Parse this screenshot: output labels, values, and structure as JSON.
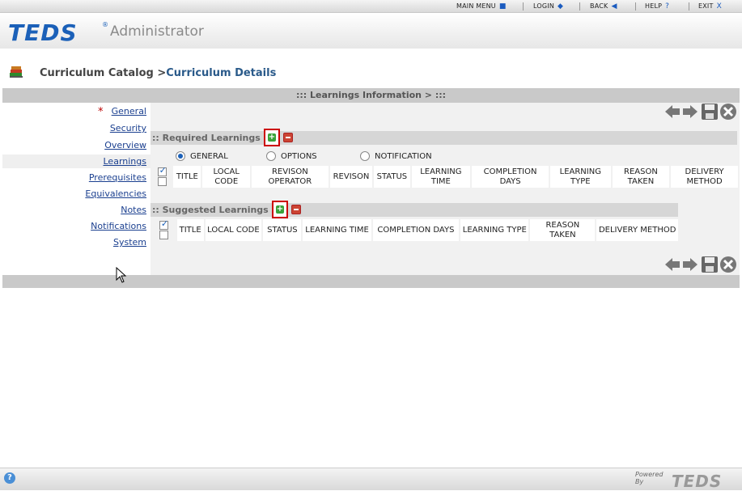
{
  "topnav": {
    "items": [
      {
        "label": "MAIN MENU",
        "icon": "square-icon"
      },
      {
        "label": "LOGIN",
        "icon": "diamond-icon"
      },
      {
        "label": "BACK",
        "icon": "back-arrow-icon"
      },
      {
        "label": "HELP",
        "icon": "question-icon"
      },
      {
        "label": "EXIT",
        "icon": "close-x-icon"
      }
    ],
    "icon_glyphs": [
      "■",
      "◆",
      "◀",
      "?",
      "X"
    ]
  },
  "header": {
    "logo": "TEDS",
    "logo_mark": "®",
    "subtitle": "Administrator"
  },
  "breadcrumb": {
    "parent": "Curriculum Catalog",
    "separator": ">",
    "current": "Curriculum Details"
  },
  "titlebar": {
    "text": "::: Learnings Information >  :::"
  },
  "sidebar": {
    "items": [
      {
        "label": "General",
        "required": true
      },
      {
        "label": "Security"
      },
      {
        "label": "Overview"
      },
      {
        "label": "Learnings",
        "active": true
      },
      {
        "label": "Prerequisites"
      },
      {
        "label": "Equivalencies"
      },
      {
        "label": "Notes"
      },
      {
        "label": "Notifications"
      },
      {
        "label": "System"
      }
    ],
    "required_mark": "*"
  },
  "required": {
    "title": ":: Required Learnings",
    "add_glyph": "+",
    "radios": [
      {
        "label": "GENERAL",
        "selected": true
      },
      {
        "label": "OPTIONS",
        "selected": false
      },
      {
        "label": "NOTIFICATION",
        "selected": false
      }
    ],
    "columns": [
      "TITLE",
      "LOCAL CODE",
      "REVISON OPERATOR",
      "REVISON",
      "STATUS",
      "LEARNING TIME",
      "COMPLETION DAYS",
      "LEARNING TYPE",
      "REASON TAKEN",
      "DELIVERY METHOD"
    ]
  },
  "suggested": {
    "title": ":: Suggested Learnings",
    "add_glyph": "+",
    "columns": [
      "TITLE",
      "LOCAL CODE",
      "STATUS",
      "LEARNING TIME",
      "COMPLETION DAYS",
      "LEARNING TYPE",
      "REASON TAKEN",
      "DELIVERY METHOD"
    ]
  },
  "footer": {
    "help_glyph": "?",
    "powered_by": "Powered By",
    "logo": "TEDS"
  },
  "colors": {
    "brand_blue": "#1b60b8",
    "link_blue": "#1a3f8f",
    "highlight_red": "#cc0000",
    "add_green": "#3aa23a"
  }
}
